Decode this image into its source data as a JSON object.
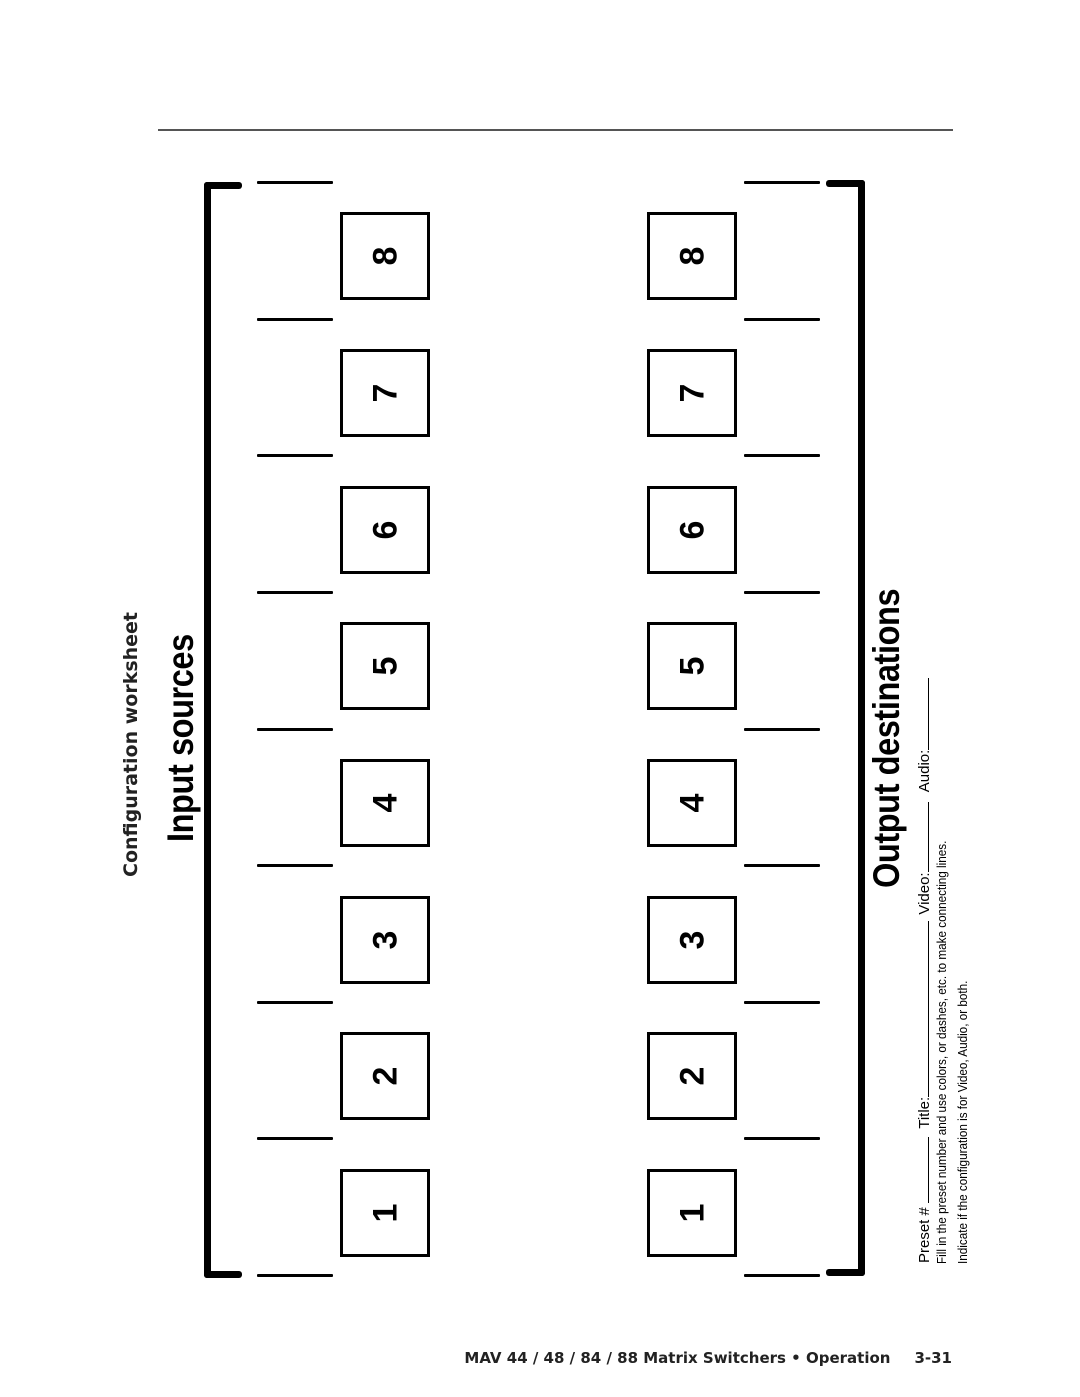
{
  "page": {
    "section_title": "Configuration worksheet",
    "input_heading": "Input  sources",
    "output_heading": "Output destinations"
  },
  "inputs": {
    "boxes": [
      "8",
      "7",
      "6",
      "5",
      "4",
      "3",
      "2",
      "1"
    ]
  },
  "outputs": {
    "boxes": [
      "8",
      "7",
      "6",
      "5",
      "4",
      "3",
      "2",
      "1"
    ]
  },
  "form": {
    "preset_label": "Preset #",
    "title_label": "Title:",
    "video_label": "Video:",
    "audio_label": "Audio:",
    "instruction_1": "Fill in the preset number and use colors, or dashes, etc. to make connecting lines.",
    "instruction_2": "Indicate if the configuration is for Video, Audio, or both."
  },
  "footer": {
    "text": "MAV 44 / 48 / 84 / 88 Matrix Switchers • Operation",
    "page_number": "3-31"
  }
}
